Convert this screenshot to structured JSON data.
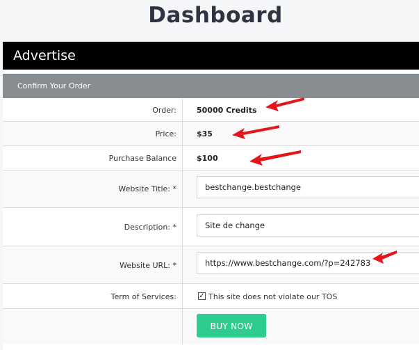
{
  "page": {
    "title": "Dashboard"
  },
  "card": {
    "title": "Advertise"
  },
  "panel": {
    "title": "Confirm Your Order"
  },
  "order": {
    "order_label": "Order:",
    "order_value": "50000 Credits",
    "price_label": "Price:",
    "price_value": "$35",
    "balance_label": "Purchase Balance",
    "balance_value": "$100",
    "website_title_label": "Website Title: *",
    "website_title_value": "bestchange.bestchange",
    "description_label": "Description: *",
    "description_value": "Site de change",
    "website_url_label": "Website URL: *",
    "website_url_value": "https://www.bestchange.com/?p=242783",
    "tos_label": "Term of Services:",
    "tos_checkbox_text": "This site does not violate our TOS",
    "tos_checked": true,
    "buy_button_label": "BUY NOW"
  },
  "colors": {
    "header_bg": "#000000",
    "panel_bg": "#888d91",
    "button_bg": "#2ecc8f",
    "annotation_arrow": "#e4151b"
  },
  "icons": {
    "checkbox": "check-icon",
    "arrows": "annotation-arrow-icon"
  }
}
